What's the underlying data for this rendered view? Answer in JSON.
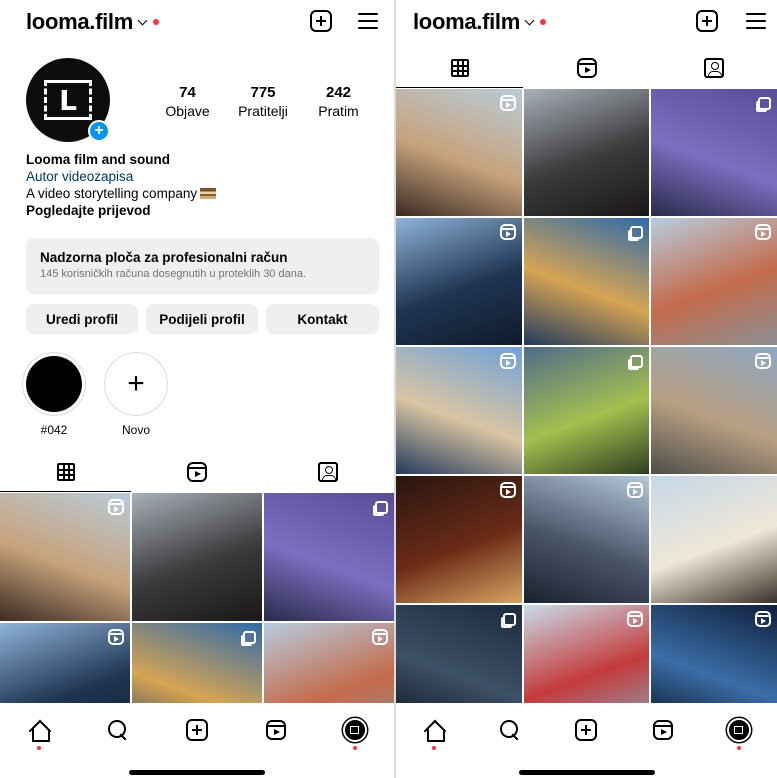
{
  "left": {
    "username": "looma.film",
    "profile": {
      "stats": [
        {
          "num": "74",
          "label": "Objave"
        },
        {
          "num": "775",
          "label": "Pratitelji"
        },
        {
          "num": "242",
          "label": "Pratim"
        }
      ],
      "name": "Looma film and sound",
      "category": "Autor videozapisa",
      "bio": "A video storytelling company",
      "translate": "Pogledajte prijevod",
      "avatar_logo": "L"
    },
    "dashboard": {
      "title": "Nadzorna ploča za profesionalni račun",
      "subtitle": "145 korisničkih računa dosegnutih u proteklih 30 dana."
    },
    "buttons": [
      "Uredi profil",
      "Podijeli profil",
      "Kontakt"
    ],
    "highlights": [
      {
        "label": "#042",
        "type": "story"
      },
      {
        "label": "Novo",
        "type": "new",
        "glyph": "+"
      }
    ]
  },
  "right": {
    "username": "looma.film"
  },
  "tabs": [
    {
      "icon": "grid-icon",
      "active": true
    },
    {
      "icon": "reels-icon",
      "active": false
    },
    {
      "icon": "tagged-icon",
      "active": false
    }
  ],
  "nav": [
    {
      "icon": "home-icon",
      "dot": true
    },
    {
      "icon": "search-icon",
      "dot": false
    },
    {
      "icon": "create-icon",
      "dot": false
    },
    {
      "icon": "reels-icon",
      "dot": false
    },
    {
      "icon": "profile-icon",
      "dot": true
    }
  ],
  "posts": [
    {
      "desc": "street-festival-crowd",
      "badge": "reel",
      "colors": [
        "#b9cbd8",
        "#c7a27c",
        "#3b2a22"
      ]
    },
    {
      "desc": "band-performing-indoors",
      "badge": "none",
      "colors": [
        "#a9b0b8",
        "#3b3a3c",
        "#1b1716"
      ]
    },
    {
      "desc": "hooded-dancer-graffiti",
      "badge": "multi",
      "colors": [
        "#5a4c96",
        "#7b6fc1",
        "#2b2a4a"
      ]
    },
    {
      "desc": "silhouette-against-light",
      "badge": "reel",
      "colors": [
        "#8fb4d8",
        "#1f3553",
        "#0e1a2b"
      ]
    },
    {
      "desc": "drinks-on-table",
      "badge": "multi",
      "colors": [
        "#2f6aa8",
        "#d6a454",
        "#1f3a5e"
      ]
    },
    {
      "desc": "town-church-tower",
      "badge": "reel",
      "colors": [
        "#b8cce0",
        "#c46b4b",
        "#8b8f93"
      ]
    },
    {
      "desc": "harbor-old-town",
      "badge": "reel",
      "colors": [
        "#6fa2d8",
        "#d9c5a3",
        "#243a5c"
      ]
    },
    {
      "desc": "mountain-biker",
      "badge": "multi",
      "colors": [
        "#4f6b8a",
        "#a4c04f",
        "#2e3d22"
      ]
    },
    {
      "desc": "couple-running-park",
      "badge": "reel",
      "colors": [
        "#8fa8c2",
        "#b99f82",
        "#4d4e4a"
      ]
    },
    {
      "desc": "beer-bottles",
      "badge": "reel",
      "colors": [
        "#2a1510",
        "#6a2b17",
        "#d6a463"
      ]
    },
    {
      "desc": "runners-on-stairs",
      "badge": "reel",
      "colors": [
        "#b5c9dc",
        "#4b5568",
        "#1a2130"
      ]
    },
    {
      "desc": "man-with-drone-castle",
      "badge": "none",
      "colors": [
        "#c6d7e8",
        "#efe7d7",
        "#3b3029"
      ]
    },
    {
      "desc": "man-in-dark-hoodie",
      "badge": "multi",
      "colors": [
        "#1c2b3c",
        "#3c5067",
        "#0d151f"
      ]
    },
    {
      "desc": "skier-red-jacket",
      "badge": "reel",
      "colors": [
        "#c9dceb",
        "#c43b3b",
        "#8aa3b6"
      ]
    },
    {
      "desc": "title-card-blue",
      "badge": "reel",
      "colors": [
        "#0f1f3b",
        "#3b6ea8",
        "#08111f"
      ]
    }
  ]
}
